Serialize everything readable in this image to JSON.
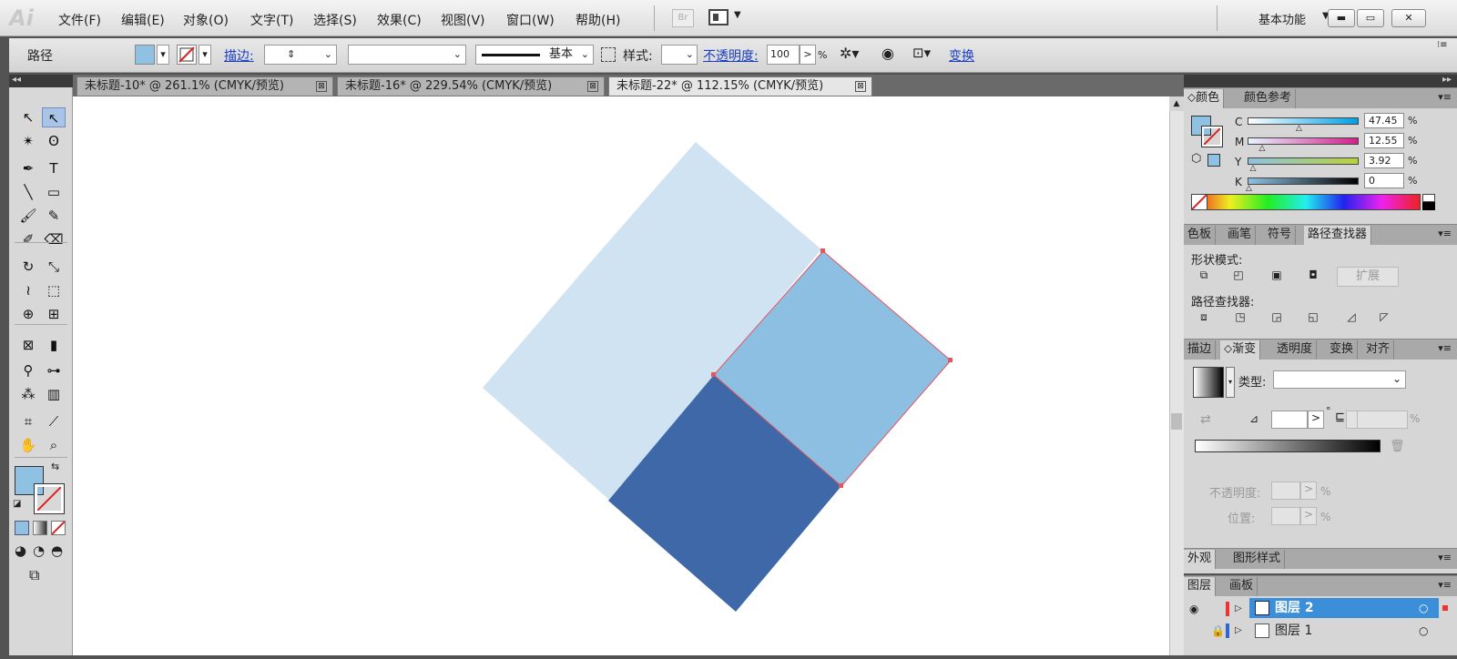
{
  "app": {
    "logo": "Ai"
  },
  "menu": {
    "items": [
      "文件(F)",
      "编辑(E)",
      "对象(O)",
      "文字(T)",
      "选择(S)",
      "效果(C)",
      "视图(V)",
      "窗口(W)",
      "帮助(H)"
    ],
    "bridge": "Br",
    "workspace": "基本功能",
    "caret": "▼",
    "win": {
      "min": "▬",
      "max": "▭",
      "close": "✕"
    }
  },
  "control": {
    "selection_label": "路径",
    "stroke_label": "描边:",
    "stroke_style": "基本",
    "style_label": "样式:",
    "opacity_label": "不透明度:",
    "opacity_value": "100",
    "opacity_arrow": ">",
    "opacity_unit": "%",
    "transform_label": "变换",
    "fill_color": "#8fc1e3"
  },
  "tabs": [
    {
      "label": "未标题-10* @ 261.1% (CMYK/预览)",
      "active": false
    },
    {
      "label": "未标题-16* @ 229.54% (CMYK/预览)",
      "active": false
    },
    {
      "label": "未标题-22* @ 112.15% (CMYK/预览)",
      "active": true
    }
  ],
  "tab_close": "⊠",
  "toolbar": {
    "collapse": "◂◂",
    "tools": [
      "selection-icon",
      "direct-selection-icon",
      "magic-wand-icon",
      "lasso-icon",
      "pen-icon",
      "type-icon",
      "line-icon",
      "rectangle-icon",
      "paintbrush-icon",
      "pencil-icon",
      "blob-brush-icon",
      "eraser-icon",
      "rotate-icon",
      "scale-icon",
      "warp-icon",
      "free-transform-icon",
      "shape-builder-icon",
      "perspective-grid-icon",
      "mesh-icon",
      "gradient-icon",
      "eyedropper-icon",
      "blend-icon",
      "symbol-sprayer-icon",
      "column-graph-icon",
      "artboard-icon",
      "slice-icon",
      "hand-icon",
      "zoom-icon"
    ]
  },
  "canvas": {
    "colors": {
      "light": "#cfe3f3",
      "mid": "#8cbfe2",
      "dark": "#3e68a8",
      "selection": "#e8545c"
    }
  },
  "color_panel": {
    "tabs": [
      "颜色",
      "颜色参考"
    ],
    "channels": [
      {
        "name": "C",
        "value": "47.45",
        "unit": "%",
        "level": 47.45
      },
      {
        "name": "M",
        "value": "12.55",
        "unit": "%",
        "level": 12.55
      },
      {
        "name": "Y",
        "value": "3.92",
        "unit": "%",
        "level": 3.92
      },
      {
        "name": "K",
        "value": "0",
        "unit": "%",
        "level": 0
      }
    ]
  },
  "pathfinder_panel": {
    "tabs": [
      "色板",
      "画笔",
      "符号",
      "路径查找器"
    ],
    "shape_modes_label": "形状模式:",
    "expand_label": "扩展",
    "pathfinders_label": "路径查找器:"
  },
  "gradient_panel": {
    "tabs": [
      "描边",
      "渐变",
      "透明度",
      "变换",
      "对齐"
    ],
    "type_label": "类型:",
    "opacity_label": "不透明度:",
    "position_label": "位置:",
    "arrow": ">",
    "unit": "%",
    "degree": "°"
  },
  "appearance_panel": {
    "tabs": [
      "外观",
      "图形样式"
    ]
  },
  "layers_panel": {
    "tabs": [
      "图层",
      "画板"
    ],
    "layers": [
      {
        "name": "图层 2",
        "selected": true
      },
      {
        "name": "图层 1",
        "selected": false
      }
    ]
  },
  "panel_menu": "▾≡"
}
